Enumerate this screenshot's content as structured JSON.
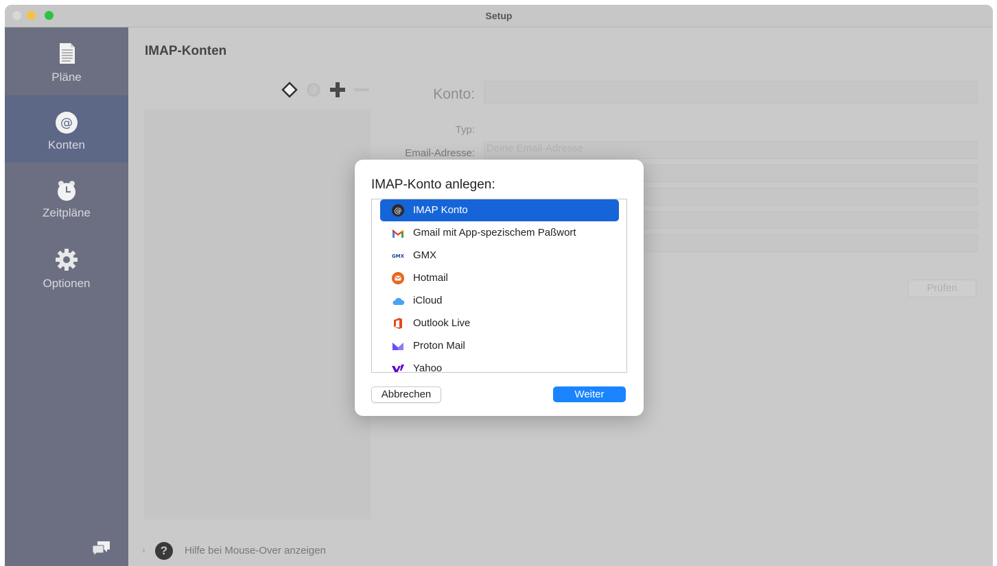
{
  "window": {
    "title": "Setup"
  },
  "sidebar": {
    "items": [
      {
        "label": "Pläne",
        "icon": "document-icon"
      },
      {
        "label": "Konten",
        "icon": "at-sign-icon"
      },
      {
        "label": "Zeitpläne",
        "icon": "alarm-clock-icon"
      },
      {
        "label": "Optionen",
        "icon": "gear-icon"
      }
    ],
    "active": "Konten"
  },
  "main": {
    "title": "IMAP-Konten",
    "form": {
      "konto_label": "Konto:",
      "typ_label": "Typ:",
      "email_label": "Email-Adresse:",
      "email_placeholder": "Deine Email-Adresse",
      "check_button": "Prüfen"
    },
    "help": {
      "label": "Hilfe bei Mouse-Over anzeigen"
    }
  },
  "dialog": {
    "title": "IMAP-Konto anlegen:",
    "options": [
      {
        "label": "IMAP Konto",
        "icon": "at-sign-icon",
        "selected": true
      },
      {
        "label": "Gmail mit App-spezischem Paßwort",
        "icon": "gmail-icon"
      },
      {
        "label": "GMX",
        "icon": "gmx-icon",
        "icon_text": "GMX"
      },
      {
        "label": "Hotmail",
        "icon": "hotmail-icon"
      },
      {
        "label": "iCloud",
        "icon": "icloud-icon"
      },
      {
        "label": "Outlook Live",
        "icon": "office-icon"
      },
      {
        "label": "Proton Mail",
        "icon": "proton-mail-icon"
      },
      {
        "label": "Yahoo",
        "icon": "yahoo-icon"
      }
    ],
    "cancel_label": "Abbrechen",
    "next_label": "Weiter"
  },
  "colors": {
    "accent": "#1a84ff",
    "selection": "#1665d8",
    "sidebar": "#6b6f81"
  }
}
